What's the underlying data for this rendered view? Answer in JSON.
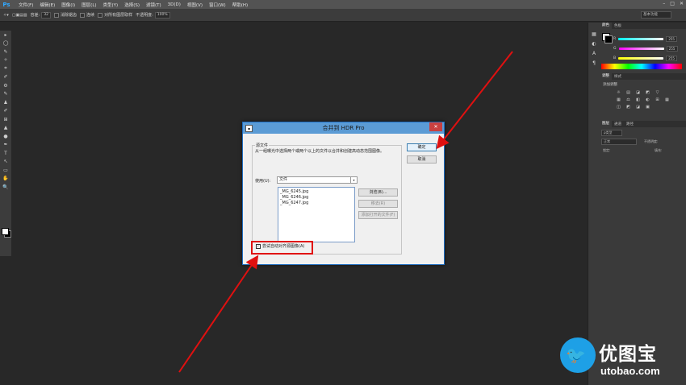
{
  "app": {
    "logo": "Ps"
  },
  "menubar": {
    "items": [
      "文件(F)",
      "编辑(E)",
      "图像(I)",
      "图层(L)",
      "类型(Y)",
      "选择(S)",
      "滤镜(T)",
      "3D(D)",
      "视图(V)",
      "窗口(W)",
      "帮助(H)"
    ],
    "controls": [
      "–",
      "□",
      "✕"
    ]
  },
  "options": {
    "tolerance_label": "容差:",
    "tolerance_value": "32",
    "antialias_label": "消除锯齿",
    "contiguous_label": "连续",
    "all_layers_label": "对所有图层取样",
    "opacity_label": "不透明度:",
    "opacity_value": "100%",
    "workspace": "基本功能"
  },
  "tools": [
    "▸",
    "◯",
    "✎",
    "✧",
    "⌗",
    "✐",
    "⚙",
    "✎",
    "♟",
    "✐",
    "⊞",
    "▲",
    "●",
    "✒",
    "T",
    "↖",
    "▭",
    "✋",
    "🔍"
  ],
  "dock_icons": [
    "▦",
    "◐",
    "A",
    "¶"
  ],
  "panels": {
    "color_tabs": [
      "颜色",
      "色板"
    ],
    "color_rows": [
      {
        "label": "R",
        "value": "255",
        "color": "#ff5050"
      },
      {
        "label": "G",
        "value": "255",
        "color": "#c040c0"
      },
      {
        "label": "B",
        "value": "255",
        "color": "#9060e0"
      }
    ],
    "adjust_tabs": [
      "调整",
      "样式"
    ],
    "adjust_title": "添加调整",
    "adjust_icons": [
      "☼",
      "▤",
      "◪",
      "◩",
      "▽",
      "",
      "▦",
      "⚖",
      "◧",
      "◐",
      "⊞",
      "▦",
      "◫",
      "◩",
      "◪",
      "▣"
    ],
    "layers_tabs": [
      "图层",
      "通道",
      "路径"
    ],
    "layers_kind": "ρ类型",
    "layers_blend": "正常",
    "layers_opacity_label": "不透明度:",
    "layers_lock_label": "锁定:",
    "layers_fill_label": "填充:"
  },
  "dialog": {
    "title": "合并到 HDR Pro",
    "close": "✕",
    "source_legend": "源文件",
    "instructions": "从一组曝光中选择两个或两个以上的文件以合并和创建高动态范围图像。",
    "use_label": "使用(U):",
    "use_value": "文件",
    "files": [
      "_MG_6245.jpg",
      "_MG_6246.jpg",
      "_MG_6247.jpg"
    ],
    "browse": "浏览(B)...",
    "remove": "移去(R)",
    "add_open": "添加打开的文件(F)",
    "ok": "确定",
    "cancel": "取消",
    "auto_align": "尝试自动对齐源图像(A)",
    "auto_align_checked": "✓"
  },
  "watermark": {
    "icon": "🐦",
    "cn": "优图宝",
    "url": "utobao.com"
  },
  "colors": {
    "highlight": "#e01010",
    "accent": "#5b9bd5"
  }
}
